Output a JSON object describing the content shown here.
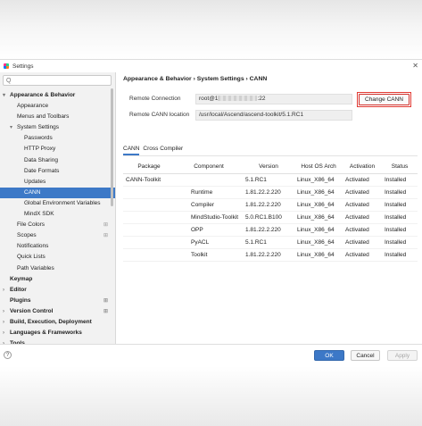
{
  "window": {
    "title": "Settings"
  },
  "search": {
    "placeholder": "Q"
  },
  "sidebar": {
    "items": [
      {
        "label": "Appearance & Behavior",
        "indent": 0,
        "arrow": "▾",
        "bold": true
      },
      {
        "label": "Appearance",
        "indent": 1
      },
      {
        "label": "Menus and Toolbars",
        "indent": 1
      },
      {
        "label": "System Settings",
        "indent": 1,
        "arrow": "▾"
      },
      {
        "label": "Passwords",
        "indent": 2
      },
      {
        "label": "HTTP Proxy",
        "indent": 2
      },
      {
        "label": "Data Sharing",
        "indent": 2
      },
      {
        "label": "Date Formats",
        "indent": 2
      },
      {
        "label": "Updates",
        "indent": 2
      },
      {
        "label": "CANN",
        "indent": 2,
        "selected": true
      },
      {
        "label": "Global Environment Variables",
        "indent": 2
      },
      {
        "label": "MindX SDK",
        "indent": 2
      },
      {
        "label": "File Colors",
        "indent": 1,
        "mark": "⊞"
      },
      {
        "label": "Scopes",
        "indent": 1,
        "mark": "⊞"
      },
      {
        "label": "Notifications",
        "indent": 1
      },
      {
        "label": "Quick Lists",
        "indent": 1
      },
      {
        "label": "Path Variables",
        "indent": 1
      },
      {
        "label": "Keymap",
        "indent": 0,
        "bold": true
      },
      {
        "label": "Editor",
        "indent": 0,
        "arrow": "›",
        "bold": true
      },
      {
        "label": "Plugins",
        "indent": 0,
        "bold": true,
        "mark": "⊞"
      },
      {
        "label": "Version Control",
        "indent": 0,
        "arrow": "›",
        "bold": true,
        "mark": "⊞"
      },
      {
        "label": "Build, Execution, Deployment",
        "indent": 0,
        "arrow": "›",
        "bold": true
      },
      {
        "label": "Languages & Frameworks",
        "indent": 0,
        "arrow": "›",
        "bold": true
      },
      {
        "label": "Tools",
        "indent": 0,
        "arrow": "›",
        "bold": true
      }
    ]
  },
  "content": {
    "breadcrumb": "Appearance & Behavior  ›  System Settings  ›  CANN",
    "remote_connection_label": "Remote Connection",
    "remote_connection_prefix": "root@1",
    "remote_connection_suffix": ":22",
    "remote_location_label": "Remote CANN location",
    "remote_location_value": "/usr/local/Ascend/ascend-toolkit/5.1.RC1",
    "change_button": "Change CANN",
    "tabs": [
      "CANN",
      "Cross Compiler"
    ],
    "table": {
      "headers": [
        "Package",
        "Component",
        "Version",
        "Host OS Arch",
        "Activation",
        "Status"
      ],
      "rows": [
        [
          "CANN-Toolkit",
          "",
          "5.1.RC1",
          "Linux_X86_64",
          "Activated",
          "Installed"
        ],
        [
          "",
          "Runtime",
          "1.81.22.2.220",
          "Linux_X86_64",
          "Activated",
          "Installed"
        ],
        [
          "",
          "Compiler",
          "1.81.22.2.220",
          "Linux_X86_64",
          "Activated",
          "Installed"
        ],
        [
          "",
          "MindStudio-Toolkit",
          "5.0.RC1.B100",
          "Linux_X86_64",
          "Activated",
          "Installed"
        ],
        [
          "",
          "OPP",
          "1.81.22.2.220",
          "Linux_X86_64",
          "Activated",
          "Installed"
        ],
        [
          "",
          "PyACL",
          "5.1.RC1",
          "Linux_X86_64",
          "Activated",
          "Installed"
        ],
        [
          "",
          "Toolkit",
          "1.81.22.2.220",
          "Linux_X86_64",
          "Activated",
          "Installed"
        ]
      ]
    }
  },
  "footer": {
    "help": "?",
    "ok": "OK",
    "cancel": "Cancel",
    "apply": "Apply"
  }
}
